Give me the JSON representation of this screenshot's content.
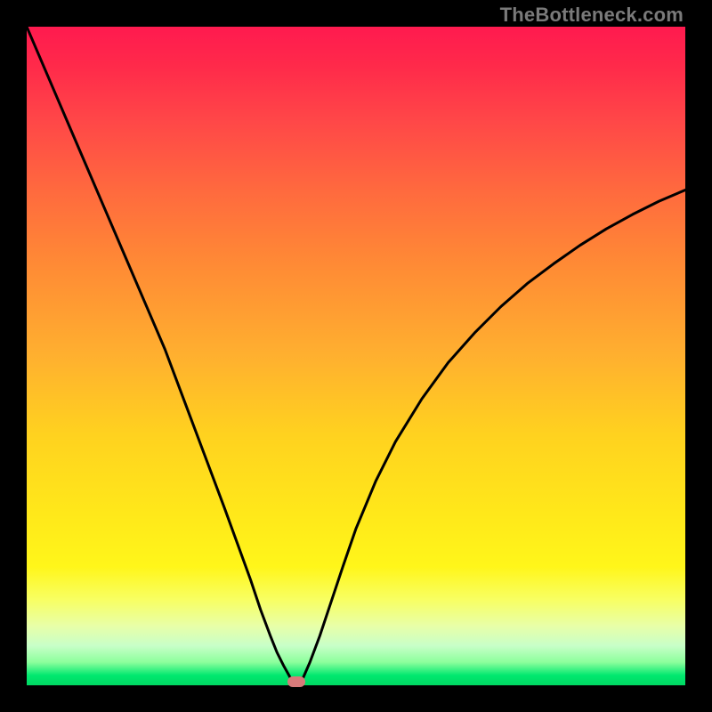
{
  "watermark": "TheBottleneck.com",
  "gradient_colors": {
    "top": "#ff1a4f",
    "mid_upper": "#ff8a35",
    "mid": "#ffd21f",
    "mid_lower": "#fff61a",
    "bottom": "#00d862"
  },
  "marker": {
    "x_fraction": 0.409,
    "y_fraction": 0.994,
    "color": "#d77a7a"
  },
  "chart_data": {
    "type": "line",
    "title": "",
    "xlabel": "",
    "ylabel": "",
    "xlim": [
      0,
      1
    ],
    "ylim": [
      0,
      1
    ],
    "annotations": [
      "TheBottleneck.com"
    ],
    "series": [
      {
        "name": "bottleneck-curve",
        "x": [
          0.0,
          0.03,
          0.06,
          0.09,
          0.12,
          0.15,
          0.18,
          0.21,
          0.24,
          0.27,
          0.3,
          0.32,
          0.34,
          0.355,
          0.37,
          0.38,
          0.39,
          0.4,
          0.409,
          0.42,
          0.43,
          0.445,
          0.46,
          0.48,
          0.5,
          0.53,
          0.56,
          0.6,
          0.64,
          0.68,
          0.72,
          0.76,
          0.8,
          0.84,
          0.88,
          0.92,
          0.96,
          1.0
        ],
        "y": [
          1.0,
          0.93,
          0.86,
          0.79,
          0.72,
          0.65,
          0.58,
          0.51,
          0.43,
          0.35,
          0.27,
          0.215,
          0.16,
          0.115,
          0.075,
          0.05,
          0.03,
          0.012,
          0.0,
          0.012,
          0.035,
          0.075,
          0.12,
          0.18,
          0.238,
          0.31,
          0.37,
          0.435,
          0.49,
          0.535,
          0.575,
          0.61,
          0.64,
          0.668,
          0.693,
          0.715,
          0.735,
          0.752
        ]
      }
    ],
    "optimum": {
      "x": 0.409,
      "y": 0.0
    }
  }
}
